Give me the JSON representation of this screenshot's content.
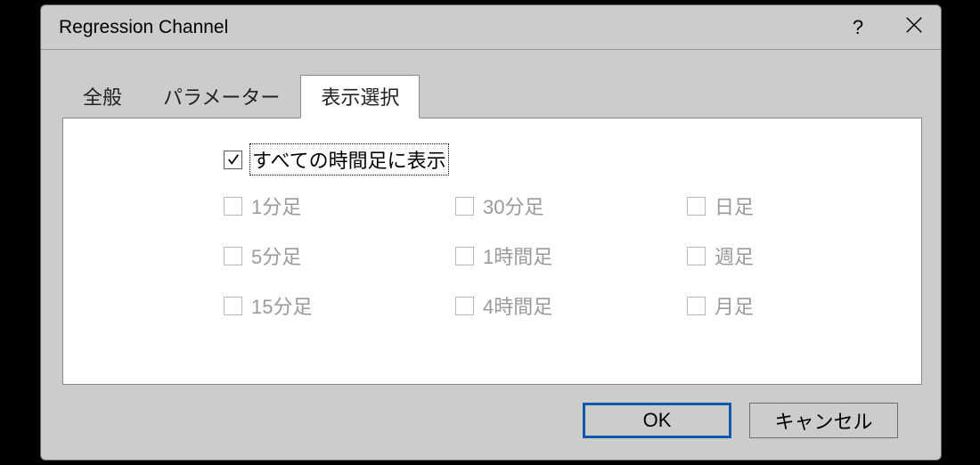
{
  "dialog": {
    "title": "Regression Channel"
  },
  "tabs": {
    "items": [
      {
        "label": "全般"
      },
      {
        "label": "パラメーター"
      },
      {
        "label": "表示選択"
      }
    ],
    "activeIndex": 2
  },
  "panel": {
    "all_timeframes": {
      "label": "すべての時間足に表示",
      "checked": true,
      "focused": true
    },
    "timeframes": [
      {
        "label": "1分足",
        "checked": false,
        "enabled": false
      },
      {
        "label": "30分足",
        "checked": false,
        "enabled": false
      },
      {
        "label": "日足",
        "checked": false,
        "enabled": false
      },
      {
        "label": "5分足",
        "checked": false,
        "enabled": false
      },
      {
        "label": "1時間足",
        "checked": false,
        "enabled": false
      },
      {
        "label": "週足",
        "checked": false,
        "enabled": false
      },
      {
        "label": "15分足",
        "checked": false,
        "enabled": false
      },
      {
        "label": "4時間足",
        "checked": false,
        "enabled": false
      },
      {
        "label": "月足",
        "checked": false,
        "enabled": false
      }
    ]
  },
  "footer": {
    "ok": "OK",
    "cancel": "キャンセル"
  }
}
